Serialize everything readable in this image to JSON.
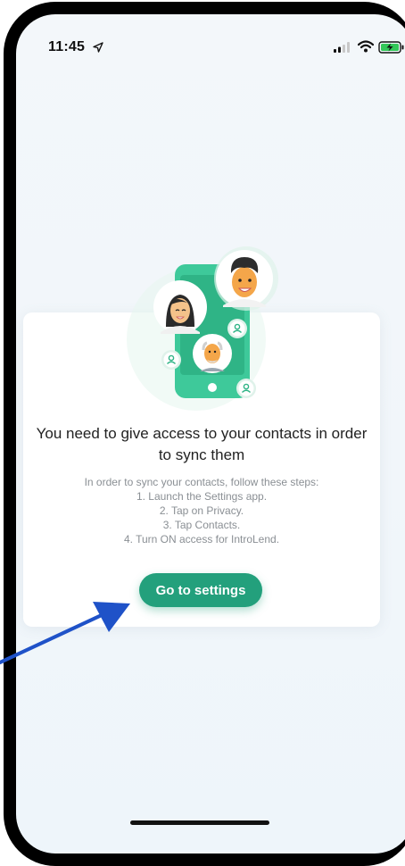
{
  "status_bar": {
    "time": "11:45"
  },
  "permission": {
    "headline": "You need to give access to your contacts in order to sync them",
    "intro": "In order to sync your contacts, follow these steps:",
    "steps": [
      "1. Launch the Settings app.",
      "2. Tap on Privacy.",
      "3. Tap Contacts.",
      "4. Turn ON access for IntroLend."
    ],
    "button_label": "Go to settings"
  },
  "colors": {
    "accent": "#23a07c",
    "phone_illustration": "#3ec99a",
    "annotation_arrow": "#1f52c8"
  },
  "icons": [
    "location-arrow-icon",
    "signal-icon",
    "wifi-icon",
    "battery-charging-icon",
    "contact-person-icon"
  ]
}
